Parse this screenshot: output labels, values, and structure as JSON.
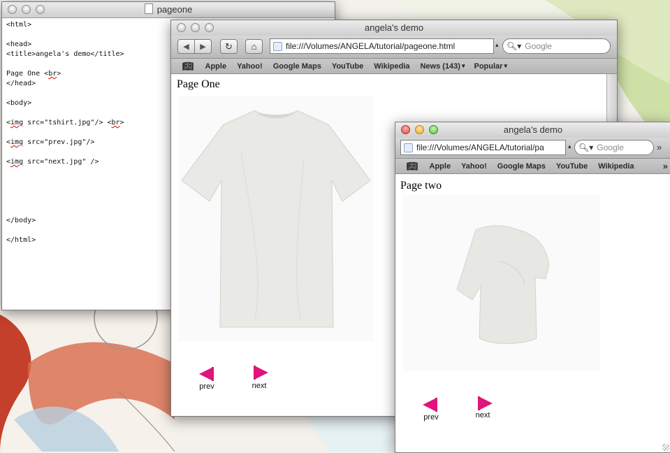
{
  "editor": {
    "title": "pageone",
    "lines": [
      "<html>",
      "",
      "<head>",
      "<title>angela's demo</title>",
      "",
      "Page One <br>",
      "</head>",
      "",
      "<body>",
      "",
      "<img src=\"tshirt.jpg\"/> <br>",
      "",
      "<img src=\"prev.jpg\"/>",
      "",
      "<img src=\"next.jpg\" />",
      "",
      "",
      "",
      "",
      "",
      "</body>",
      "",
      "</html>"
    ]
  },
  "browser1": {
    "title": "angela's demo",
    "url": "file:///Volumes/ANGELA/tutorial/pageone.html",
    "search_placeholder": "Google",
    "bookmarks": [
      "Apple",
      "Yahoo!",
      "Google Maps",
      "YouTube",
      "Wikipedia",
      "News (143)",
      "Popular"
    ],
    "heading": "Page One",
    "prev_label": "prev",
    "next_label": "next"
  },
  "browser2": {
    "title": "angela's demo",
    "url": "file:///Volumes/ANGELA/tutorial/pa",
    "search_placeholder": "Google",
    "bookmarks": [
      "Apple",
      "Yahoo!",
      "Google Maps",
      "YouTube",
      "Wikipedia"
    ],
    "heading": "Page two",
    "prev_label": "prev",
    "next_label": "next"
  },
  "colors": {
    "arrow": "#e0147a",
    "desktop_green": "#cfe0a6",
    "desktop_red": "#c4402a"
  }
}
